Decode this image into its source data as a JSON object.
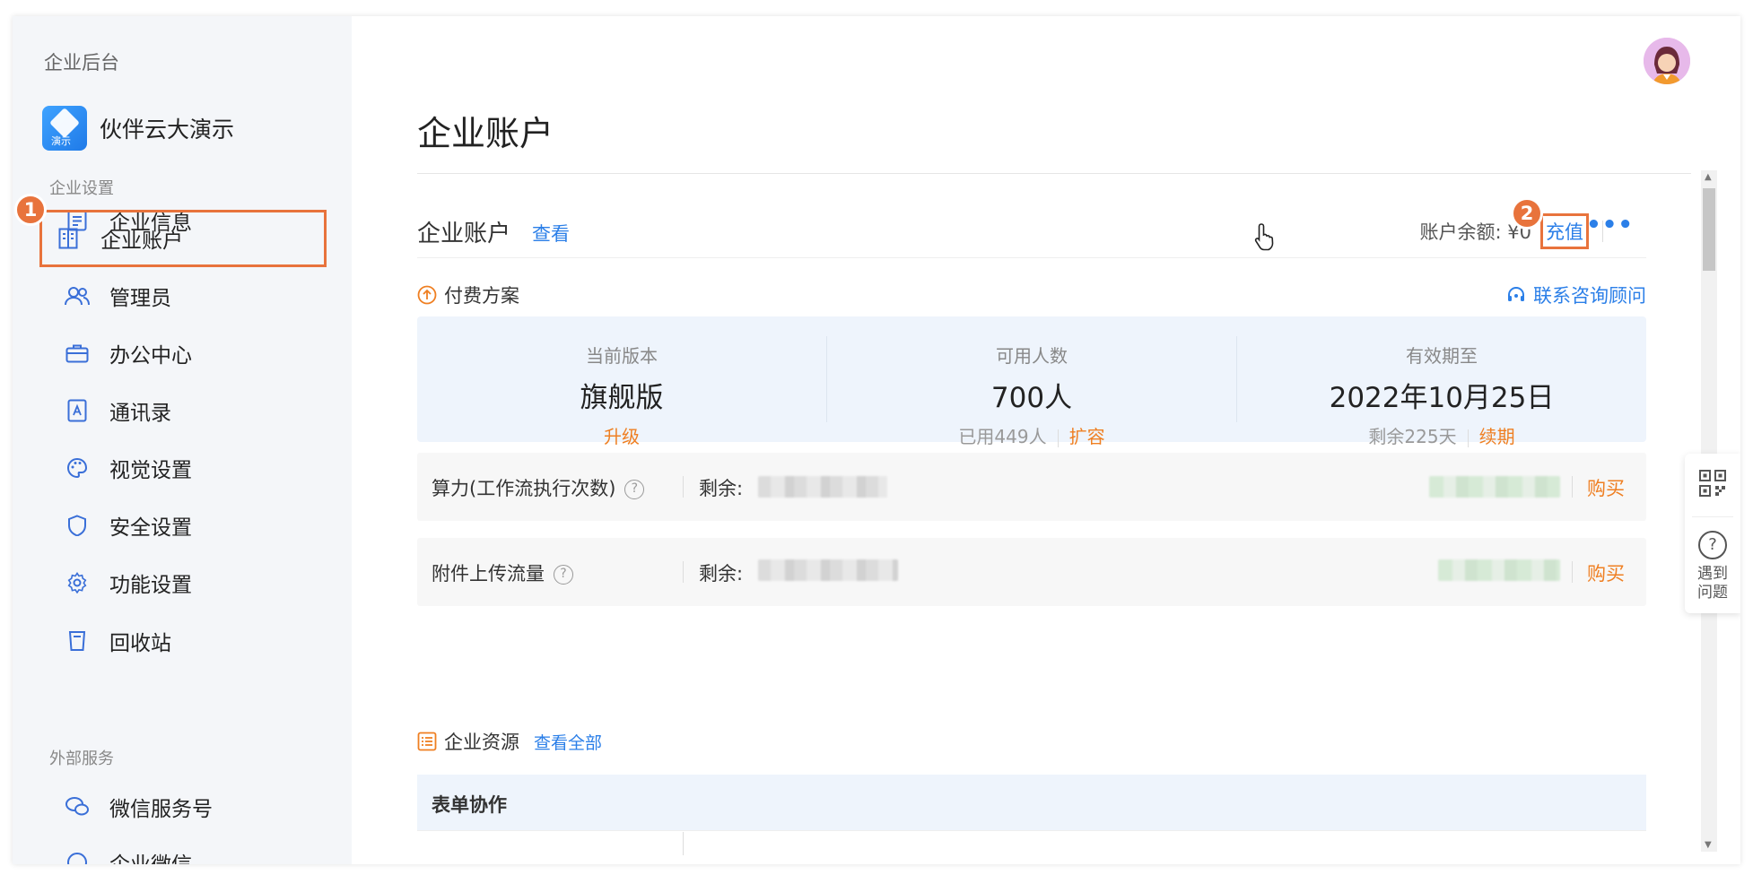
{
  "sidebar": {
    "top_label": "企业后台",
    "org_name": "伙伴云大演示",
    "org_logo_tag": "演示",
    "section_settings": "企业设置",
    "items": [
      {
        "label": "企业信息"
      },
      {
        "label": "企业账户"
      },
      {
        "label": "管理员"
      },
      {
        "label": "办公中心"
      },
      {
        "label": "通讯录"
      },
      {
        "label": "视觉设置"
      },
      {
        "label": "安全设置"
      },
      {
        "label": "功能设置"
      },
      {
        "label": "回收站"
      }
    ],
    "section_external": "外部服务",
    "external_items": [
      {
        "label": "微信服务号"
      },
      {
        "label": "企业微信"
      }
    ]
  },
  "steps": {
    "one": "1",
    "two": "2"
  },
  "main": {
    "page_title": "企业账户",
    "account": {
      "title": "企业账户",
      "view_link": "查看",
      "balance_label": "账户余额: ¥0",
      "recharge": "充值",
      "more": "•••"
    },
    "plan": {
      "title": "付费方案",
      "consult": "联系咨询顾问",
      "columns": [
        {
          "label": "当前版本",
          "value": "旗舰版",
          "action": "升级"
        },
        {
          "label": "可用人数",
          "value": "700人",
          "sub": "已用449人",
          "action": "扩容"
        },
        {
          "label": "有效期至",
          "value": "2022年10月25日",
          "sub": "剩余225天",
          "action": "续期"
        }
      ]
    },
    "resources": [
      {
        "name": "算力(工作流执行次数)",
        "help": "?",
        "remain_label": "剩余:",
        "buy": "购买"
      },
      {
        "name": "附件上传流量",
        "help": "?",
        "remain_label": "剩余:",
        "buy": "购买"
      }
    ],
    "enterprise": {
      "title": "企业资源",
      "view_all": "查看全部",
      "table_header": "表单协作"
    }
  },
  "float_panel": {
    "help_text": "遇到问题"
  },
  "colors": {
    "accent": "#2b7fe8",
    "highlight": "#e8733c",
    "orange_text": "#ef7f22"
  }
}
